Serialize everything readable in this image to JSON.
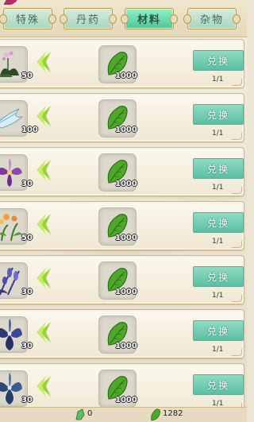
{
  "tabs": [
    {
      "label": "特殊",
      "active": false
    },
    {
      "label": "丹药",
      "active": false
    },
    {
      "label": "材料",
      "active": true
    },
    {
      "label": "杂物",
      "active": false
    }
  ],
  "rows": [
    {
      "item_icon": "purple-orchid-plant-icon",
      "item_qty": "50",
      "cost_icon": "green-leaf-icon",
      "cost_qty": "1000",
      "button_label": "兑换",
      "limit": "1/1"
    },
    {
      "item_icon": "ice-crystal-icon",
      "item_qty": "100",
      "cost_icon": "green-leaf-icon",
      "cost_qty": "1000",
      "button_label": "兑换",
      "limit": "1/1"
    },
    {
      "item_icon": "purple-flower-icon",
      "item_qty": "30",
      "cost_icon": "green-leaf-icon",
      "cost_qty": "1000",
      "button_label": "兑换",
      "limit": "1/1"
    },
    {
      "item_icon": "orange-lily-plant-icon",
      "item_qty": "50",
      "cost_icon": "green-leaf-icon",
      "cost_qty": "1000",
      "button_label": "兑换",
      "limit": "1/1"
    },
    {
      "item_icon": "lavender-plant-icon",
      "item_qty": "30",
      "cost_icon": "green-leaf-icon",
      "cost_qty": "1000",
      "button_label": "兑换",
      "limit": "1/1"
    },
    {
      "item_icon": "blue-lily-icon",
      "item_qty": "30",
      "cost_icon": "green-leaf-icon",
      "cost_qty": "1000",
      "button_label": "兑换",
      "limit": "1/1"
    },
    {
      "item_icon": "blue-lily-icon",
      "item_qty": "30",
      "cost_icon": "green-leaf-icon",
      "cost_qty": "1000",
      "button_label": "兑换",
      "limit": "1/1"
    }
  ],
  "currency": {
    "first_value": "0",
    "second_value": "1282"
  },
  "colors": {
    "button": "#5cbfa2",
    "active_tab": "#4dc89c",
    "leaf": "#4fa82a",
    "arrow": "#9ad43a"
  }
}
